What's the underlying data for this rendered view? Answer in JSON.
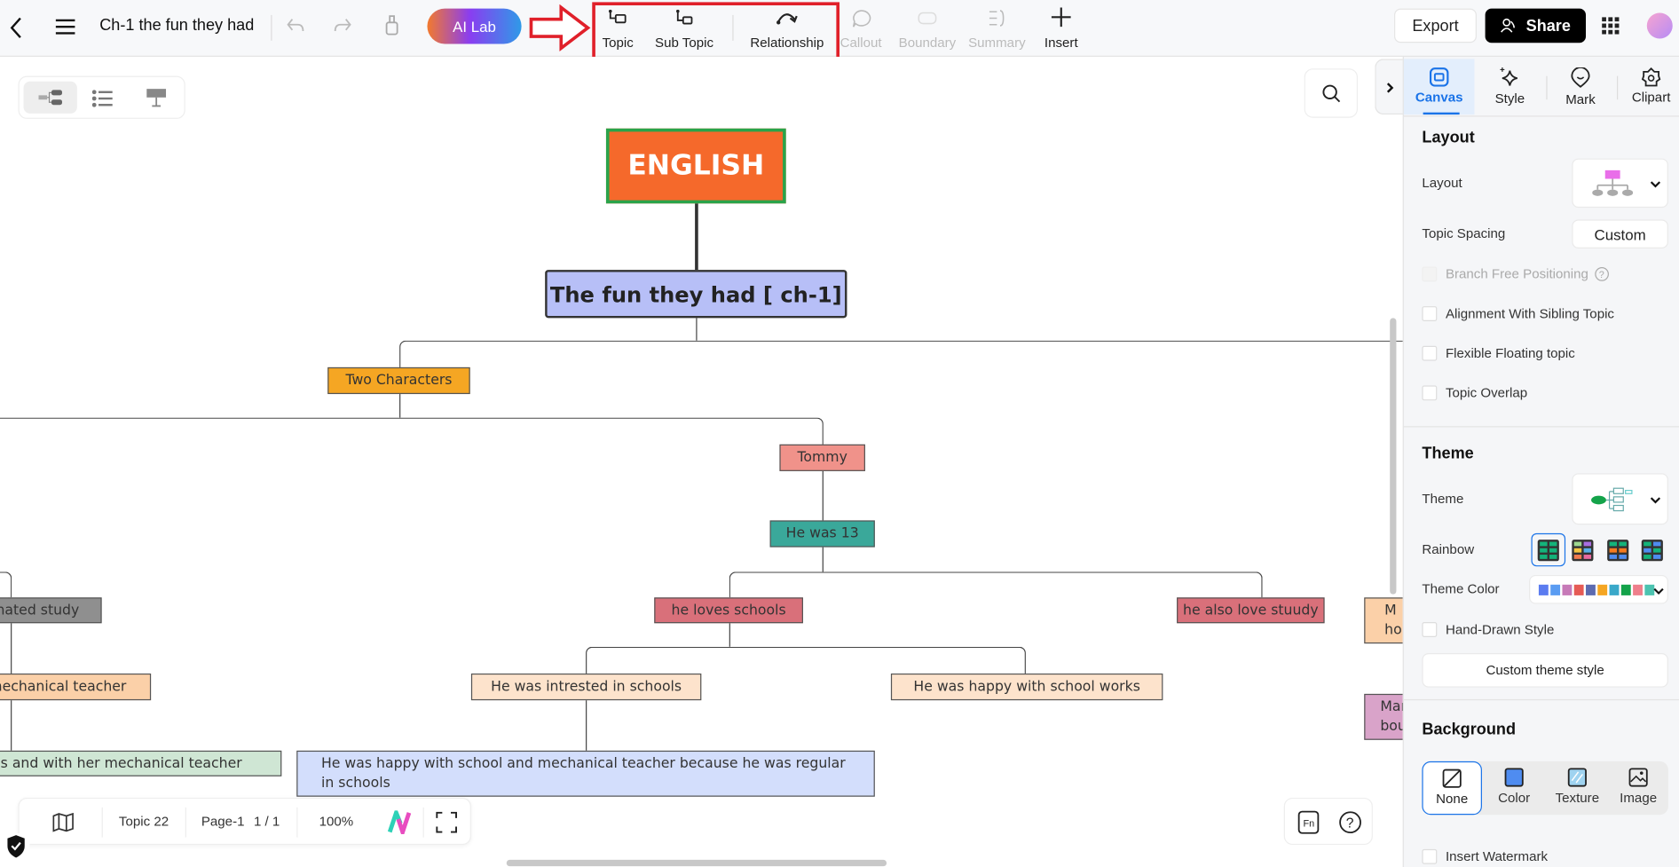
{
  "topbar": {
    "title": "Ch-1 the fun they had",
    "ai_lab": "AI Lab",
    "tools": [
      {
        "label": "Topic",
        "icon": "topic-icon"
      },
      {
        "label": "Sub Topic",
        "icon": "subtopic-icon"
      },
      {
        "label": "Relationship",
        "icon": "relationship-icon"
      },
      {
        "label": "Callout",
        "icon": "callout-icon",
        "disabled": true
      },
      {
        "label": "Boundary",
        "icon": "boundary-icon",
        "disabled": true
      },
      {
        "label": "Summary",
        "icon": "summary-icon",
        "disabled": true
      },
      {
        "label": "Insert",
        "icon": "plus-icon"
      }
    ],
    "export": "Export",
    "share": "Share",
    "highlight_color": "#e0202a"
  },
  "canvas": {
    "nodes": {
      "root": "ENGLISH",
      "main": "The fun they had [ ch-1]",
      "two_characters": "Two Characters",
      "tommy": "Tommy",
      "he_was_13": "He was 13",
      "hated_study": "hated study",
      "mech_teacher": "mechanical teacher",
      "ols_with": "ols and with her mechanical teacher",
      "loves_schools": "he loves schools",
      "also_love": "he also love stuudy",
      "intrested": "He was intrested in schools",
      "happy_works": "He was happy with school works",
      "happy_long": "He was happy with school and mechanical teacher because he was regular in schools",
      "right1_l1": "M",
      "right1_l2": "ho",
      "right2_l1": "Mar",
      "right2_l2": "bou"
    },
    "colors": {
      "root": "#f5692b",
      "root_border": "#2aa34a",
      "main": "#b7bff7"
    }
  },
  "bottombar": {
    "topic_count": "Topic 22",
    "page": "Page-1",
    "page_count": "1 / 1",
    "zoom": "100%"
  },
  "panel": {
    "tabs": [
      {
        "label": "Canvas",
        "active": true
      },
      {
        "label": "Style"
      },
      {
        "label": "Mark"
      },
      {
        "label": "Clipart"
      }
    ],
    "layout": {
      "heading": "Layout",
      "layout_label": "Layout",
      "spacing_label": "Topic Spacing",
      "spacing_value": "Custom",
      "options": [
        {
          "label": "Branch Free Positioning",
          "disabled": true
        },
        {
          "label": "Alignment With Sibling Topic"
        },
        {
          "label": "Flexible Floating topic"
        },
        {
          "label": "Topic Overlap"
        }
      ]
    },
    "theme": {
      "heading": "Theme",
      "theme_label": "Theme",
      "rainbow_label": "Rainbow",
      "color_label": "Theme Color",
      "swatches": [
        "#5b7cf0",
        "#5a9cf2",
        "#c77ab8",
        "#e65b55",
        "#5d6bb0",
        "#f5a623",
        "#3aa8c9",
        "#14a34a",
        "#ef7f8c",
        "#4cc3b0"
      ],
      "hand_drawn": "Hand-Drawn Style",
      "custom_style": "Custom theme style"
    },
    "background": {
      "heading": "Background",
      "options": [
        {
          "label": "None",
          "active": true
        },
        {
          "label": "Color"
        },
        {
          "label": "Texture"
        },
        {
          "label": "Image"
        }
      ],
      "watermark": "Insert Watermark"
    }
  }
}
